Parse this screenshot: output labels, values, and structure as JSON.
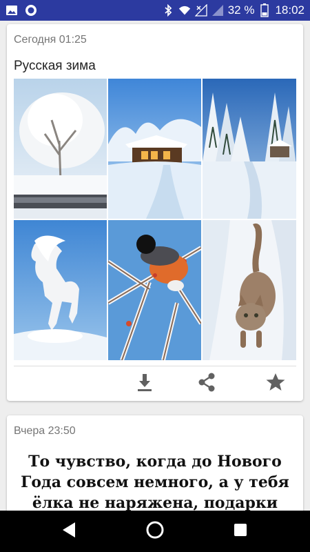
{
  "status_bar": {
    "battery_percent": "32 %",
    "time": "18:02",
    "icons": [
      "image-icon",
      "record-icon",
      "bluetooth-icon",
      "wifi-icon",
      "no-signal-icon",
      "signal-icon",
      "battery-icon"
    ]
  },
  "posts": [
    {
      "timestamp": "Сегодня 01:25",
      "title": "Русская зима",
      "photos": [
        "snowy-tree",
        "snowy-cabin",
        "snowy-forest-path",
        "white-horse",
        "bullfinch-bird",
        "kitten-in-snow"
      ],
      "actions": [
        "download-icon",
        "share-icon",
        "favorite-star-icon"
      ]
    },
    {
      "timestamp": "Вчера 23:50",
      "quote": "То чувство, когда до Нового Года совсем немного, а у тебя ёлка не наряжена, подарки"
    }
  ],
  "nav_bar": {
    "buttons": [
      "back-icon",
      "home-icon",
      "recents-icon"
    ]
  },
  "colors": {
    "status_bar": "#2c3aa0",
    "background": "#eeeeee",
    "card": "#ffffff",
    "icon_gray": "#616161"
  }
}
